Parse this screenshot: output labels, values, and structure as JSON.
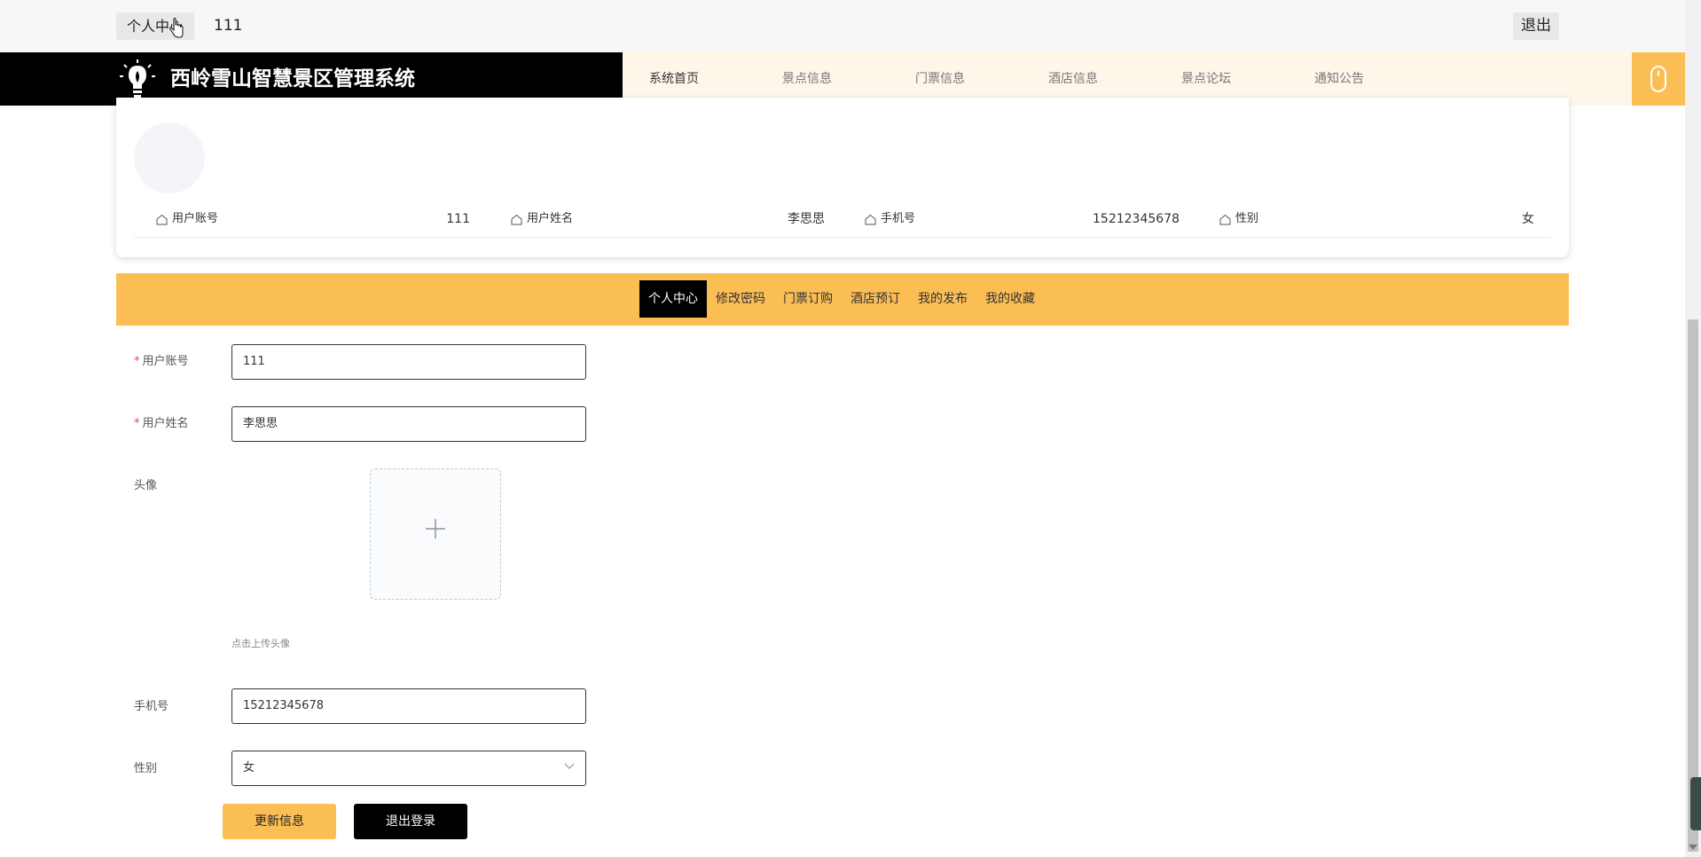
{
  "topbar": {
    "user_center": "个人中心",
    "account": "111",
    "logout": "退出"
  },
  "header": {
    "title": "西岭雪山智慧景区管理系统",
    "nav": [
      "系统首页",
      "景点信息",
      "门票信息",
      "酒店信息",
      "景点论坛",
      "通知公告"
    ]
  },
  "profile": {
    "fields": [
      {
        "label": "用户账号",
        "value": "111"
      },
      {
        "label": "用户姓名",
        "value": "李思思"
      },
      {
        "label": "手机号",
        "value": "15212345678"
      },
      {
        "label": "性别",
        "value": "女"
      }
    ]
  },
  "tabs": [
    "个人中心",
    "修改密码",
    "门票订购",
    "酒店预订",
    "我的发布",
    "我的收藏"
  ],
  "form": {
    "account_label": "用户账号",
    "account_value": "111",
    "name_label": "用户姓名",
    "name_value": "李思思",
    "avatar_label": "头像",
    "avatar_hint": "点击上传头像",
    "phone_label": "手机号",
    "phone_value": "15212345678",
    "gender_label": "性别",
    "gender_value": "女",
    "required_mark": "*"
  },
  "buttons": {
    "update": "更新信息",
    "logout": "退出登录"
  },
  "colors": {
    "accent": "#fbbe55",
    "dark": "#000000",
    "nav_bg": "#fff6ea"
  }
}
